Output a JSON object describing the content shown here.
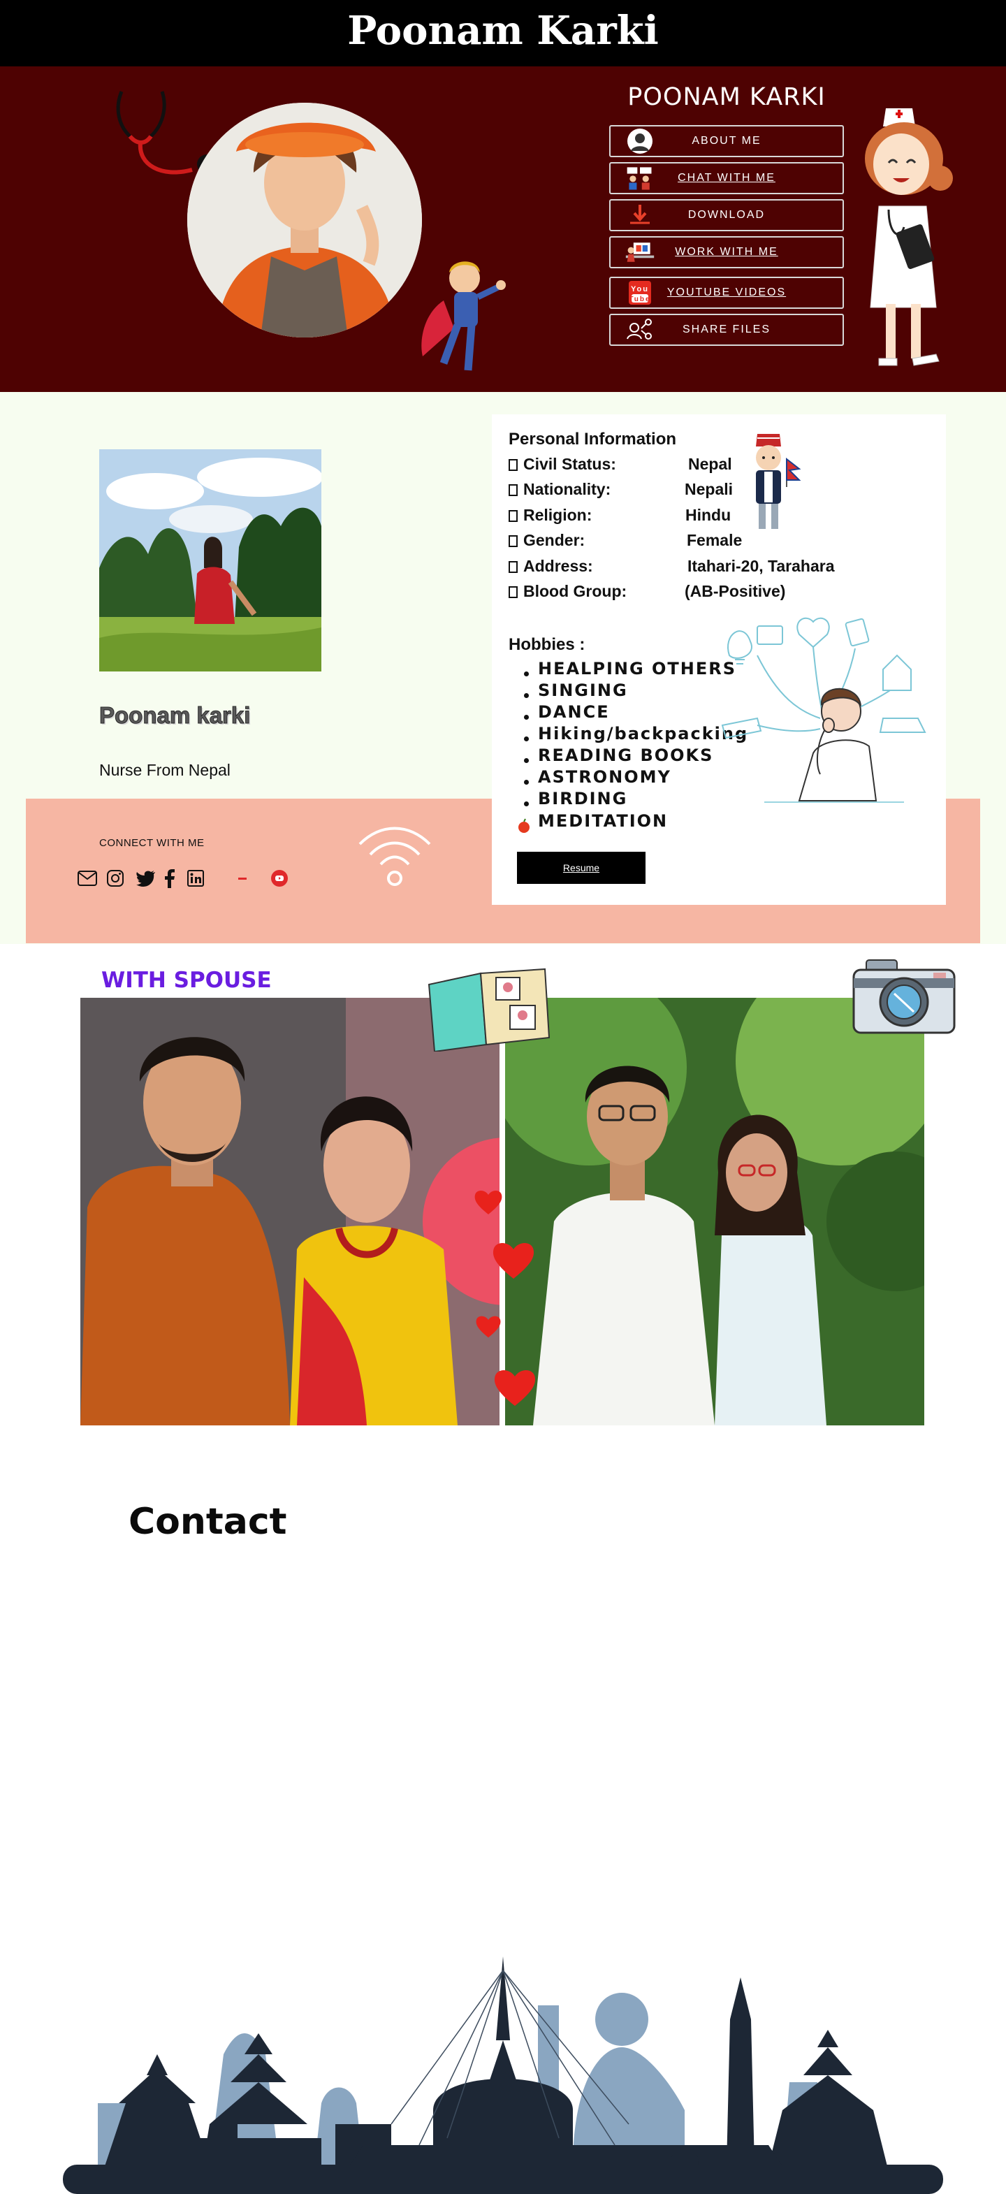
{
  "header": {
    "title": "Poonam Karki"
  },
  "hero": {
    "name": "POONAM KARKI",
    "buttons": [
      {
        "label": "ABOUT ME",
        "icon": "user-avatar-icon",
        "underline": false
      },
      {
        "label": "CHAT WITH ME",
        "icon": "chat-people-icon",
        "underline": true
      },
      {
        "label": "DOWNLOAD",
        "icon": "download-icon",
        "underline": false
      },
      {
        "label": "WORK WITH ME",
        "icon": "work-icon",
        "underline": true
      },
      {
        "label": "YOUTUBE VIDEOS",
        "icon": "youtube-icon",
        "underline": true
      },
      {
        "label": "SHARE FILES",
        "icon": "share-icon",
        "underline": false
      }
    ]
  },
  "profile": {
    "name": "Poonam karki",
    "subtitle": "Nurse From Nepal",
    "connect_label": "CONNECT WITH ME",
    "social_icons": [
      "mail-icon",
      "instagram-icon",
      "twitter-icon",
      "facebook-icon",
      "linkedin-icon",
      "minus-icon",
      "youtube-icon"
    ]
  },
  "personal_info": {
    "title": "Personal Information",
    "rows": [
      {
        "label": "Civil Status:",
        "value": "Nepal"
      },
      {
        "label": "Nationality:",
        "value": "Nepali"
      },
      {
        "label": "Religion:",
        "value": "Hindu"
      },
      {
        "label": "Gender:",
        "value": "Female"
      },
      {
        "label": "Address:",
        "value": "Itahari-20, Tarahara"
      },
      {
        "label": "Blood Group:",
        "value": "(AB-Positive)"
      }
    ],
    "hobbies_title": "Hobbies :",
    "hobbies": [
      "HEALPING OTHERS",
      "SINGING",
      "DANCE",
      "Hiking/backpacking",
      "READING BOOKS",
      "ASTRONOMY",
      "BIRDING",
      "MEDITATION"
    ],
    "resume_label": "Resume"
  },
  "spouse": {
    "title": "WITH SPOUSE"
  },
  "contact": {
    "title": "Contact"
  },
  "colors": {
    "header_bg": "#000000",
    "hero_bg": "#4e0202",
    "profile_bg": "#f7fdf0",
    "band": "#f6b6a3",
    "spouse_title": "#6a1de0",
    "skyline_dark": "#1d2735",
    "skyline_light": "#8aa6c1"
  }
}
